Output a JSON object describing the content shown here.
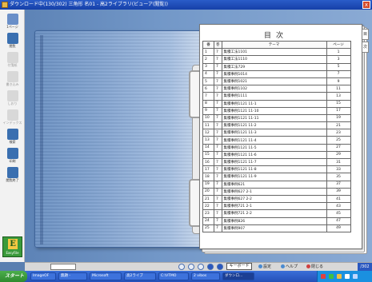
{
  "titlebar": {
    "title": "ダウンロード中(130/302) 三角形 名01 - 高2ライブラリ(ビューア(閲覧))",
    "close": "x"
  },
  "tools": [
    {
      "label": "1ページ",
      "icon": "page-icon",
      "color": "#6a8fc8",
      "enabled": true
    },
    {
      "label": "閲覧",
      "icon": "people-icon",
      "color": "#3a6fb0",
      "enabled": true
    },
    {
      "label": "付箋紙",
      "icon": "pen-icon",
      "color": "#aaa",
      "enabled": false
    },
    {
      "label": "書き込み",
      "icon": "brush-icon",
      "color": "#aaa",
      "enabled": false
    },
    {
      "label": "しおり",
      "icon": "bookmark-icon",
      "color": "#aaa",
      "enabled": false
    },
    {
      "label": "インデックス",
      "icon": "index-icon",
      "color": "#aaa",
      "enabled": false
    },
    {
      "label": "検索",
      "icon": "search-icon",
      "color": "#3a6fb0",
      "enabled": true
    },
    {
      "label": "印刷",
      "icon": "print-icon",
      "color": "#3a6fb0",
      "enabled": true
    },
    {
      "label": "閲覧終了",
      "icon": "save-icon",
      "color": "#3a6fb0",
      "enabled": true
    }
  ],
  "easyfile": {
    "label": "EasyFile",
    "letter": "E"
  },
  "index": {
    "title": "目次",
    "headers": [
      "番",
      "巻",
      "テーマ",
      "ページ"
    ],
    "rows": [
      [
        "1",
        "7",
        "集積工法1101",
        "1"
      ],
      [
        "2",
        "7",
        "集積工法1110",
        "3"
      ],
      [
        "3",
        "7",
        "集積工法729",
        "5"
      ],
      [
        "4",
        "7",
        "集積事例1014",
        "7"
      ],
      [
        "5",
        "7",
        "集積事例1021",
        "9"
      ],
      [
        "6",
        "7",
        "集積事例1102",
        "11"
      ],
      [
        "7",
        "7",
        "集積事例1111",
        "13"
      ],
      [
        "8",
        "7",
        "集積事例1121 11-1",
        "15"
      ],
      [
        "9",
        "7",
        "集積事例1121 11-10",
        "17"
      ],
      [
        "10",
        "7",
        "集積事例1121 11-11",
        "19"
      ],
      [
        "11",
        "7",
        "集積事例1121 11-2",
        "21"
      ],
      [
        "12",
        "7",
        "集積事例1121 11-3",
        "23"
      ],
      [
        "13",
        "7",
        "集積事例1121 11-4",
        "25"
      ],
      [
        "14",
        "7",
        "集積事例1121 11-5",
        "27"
      ],
      [
        "15",
        "7",
        "集積事例1121 11-6",
        "29"
      ],
      [
        "16",
        "7",
        "集積事例1121 11-7",
        "31"
      ],
      [
        "17",
        "7",
        "集積事例1121 11-8",
        "33"
      ],
      [
        "18",
        "7",
        "集積事例1121 11-9",
        "35"
      ],
      [
        "19",
        "7",
        "集積事例621",
        "37"
      ],
      [
        "20",
        "7",
        "集積事例627 2-1",
        "39"
      ],
      [
        "21",
        "7",
        "集積事例627 2-2",
        "41"
      ],
      [
        "22",
        "7",
        "集積事例721 2-1",
        "43"
      ],
      [
        "23",
        "7",
        "集積事例721 2-2",
        "45"
      ],
      [
        "24",
        "7",
        "集積事例826",
        "47"
      ],
      [
        "25",
        "7",
        "集積事例907",
        "49"
      ]
    ]
  },
  "side_tabs": [
    "目",
    "次"
  ],
  "bottom": {
    "keyboard": "キーボード",
    "links": [
      {
        "label": "設定",
        "color": "#4a8ad0"
      },
      {
        "label": "ヘルプ",
        "color": "#4a8ad0"
      },
      {
        "label": "閉じる",
        "color": "#d04040"
      }
    ],
    "counter": "/302"
  },
  "taskbar": {
    "start": "スタート",
    "items": [
      {
        "label": "ImageOF"
      },
      {
        "label": "無題 -"
      },
      {
        "label": "Microsoft"
      },
      {
        "label": "高2ライブ"
      },
      {
        "label": "C:\\VTMO"
      },
      {
        "label": "2 vibos"
      },
      {
        "label": "ダウンロ..."
      }
    ]
  }
}
